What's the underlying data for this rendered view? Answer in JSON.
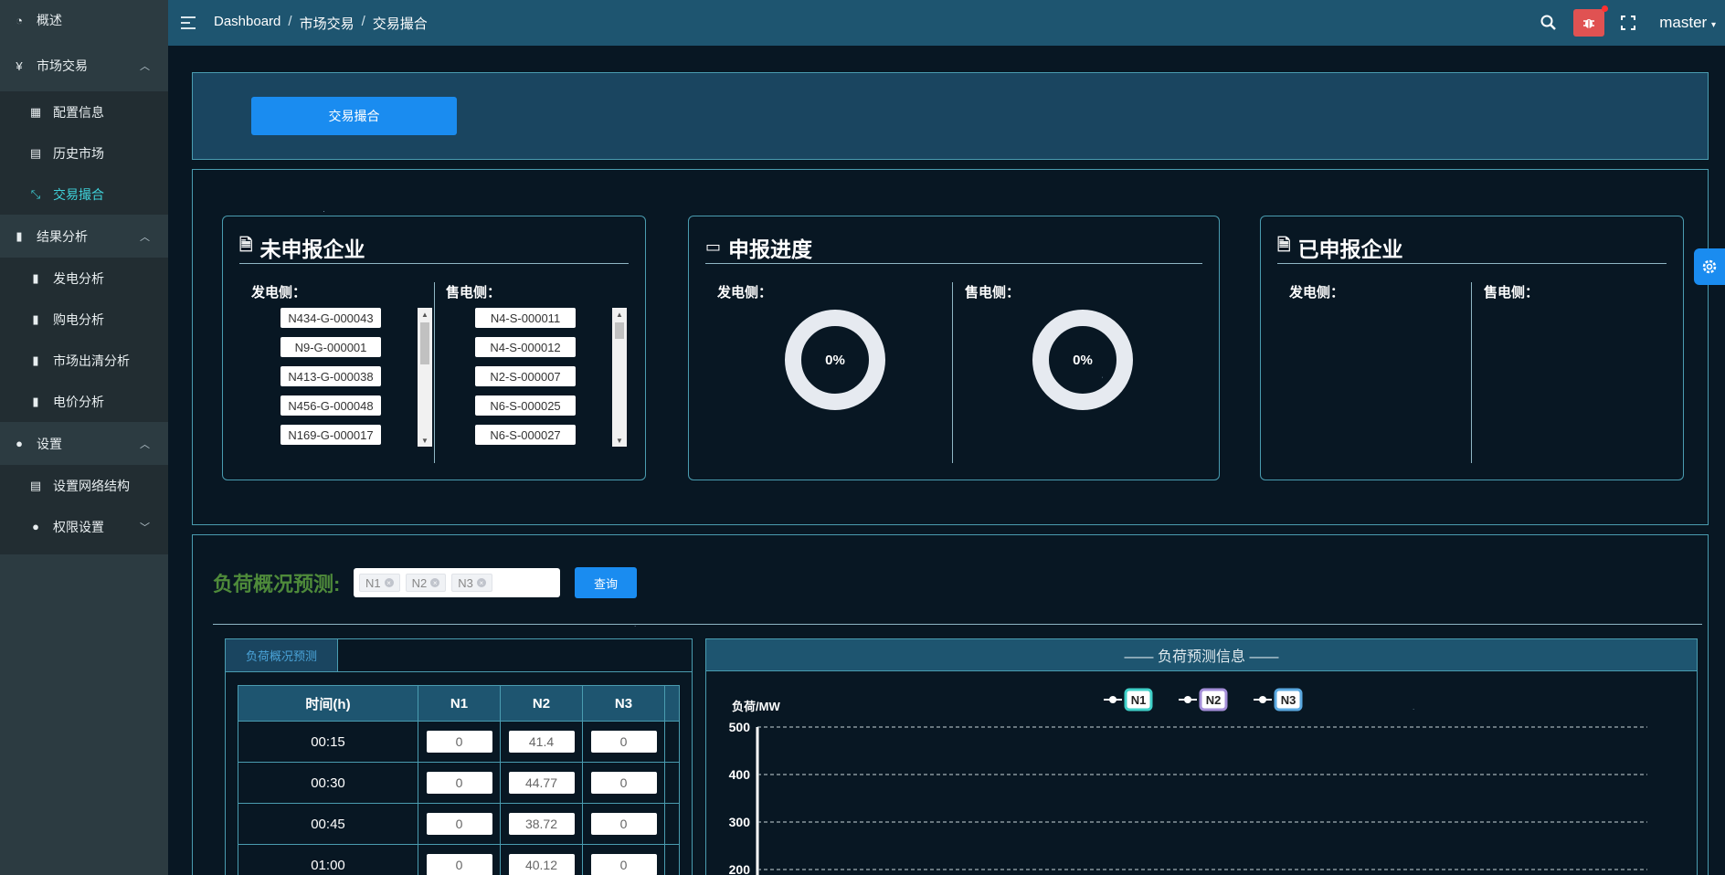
{
  "sidebar": {
    "overview": "概述",
    "market": "市场交易",
    "market_items": [
      "配置信息",
      "历史市场",
      "交易撮合"
    ],
    "analysis": "结果分析",
    "analysis_items": [
      "发电分析",
      "购电分析",
      "市场出清分析",
      "电价分析"
    ],
    "settings": "设置",
    "settings_items": [
      "设置网络结构",
      "权限设置"
    ]
  },
  "header": {
    "breadcrumb": [
      "Dashboard",
      "市场交易",
      "交易撮合"
    ],
    "user": "master"
  },
  "top": {
    "button": "交易撮合"
  },
  "cards": {
    "unreported": {
      "title": "未申报企业",
      "gen_label": "发电侧：",
      "sell_label": "售电侧：",
      "gen_list": [
        "N434-G-000043",
        "N9-G-000001",
        "N413-G-000038",
        "N456-G-000048",
        "N169-G-000017"
      ],
      "sell_list": [
        "N4-S-000011",
        "N4-S-000012",
        "N2-S-000007",
        "N6-S-000025",
        "N6-S-000027"
      ]
    },
    "progress": {
      "title": "申报进度",
      "gen_label": "发电侧：",
      "sell_label": "售电侧：",
      "gen_pct": "0%",
      "sell_pct": "0%"
    },
    "reported": {
      "title": "已申报企业",
      "gen_label": "发电侧：",
      "sell_label": "售电侧："
    }
  },
  "forecast": {
    "title": "负荷概况预测:",
    "nodes": [
      "N1",
      "N2",
      "N3"
    ],
    "query": "查询",
    "tab": "负荷概况预测",
    "columns": [
      "时间(h)",
      "N1",
      "N2",
      "N3"
    ],
    "rows": [
      [
        "00:15",
        "0",
        "41.4",
        "0"
      ],
      [
        "00:30",
        "0",
        "44.77",
        "0"
      ],
      [
        "00:45",
        "0",
        "38.72",
        "0"
      ],
      [
        "01:00",
        "0",
        "40.12",
        "0"
      ]
    ],
    "chart_head": "—— 负荷预测信息 ——"
  },
  "chart_data": {
    "type": "line",
    "ylabel": "负荷/MW",
    "yticks": [
      500,
      400,
      300,
      200
    ],
    "series": [
      {
        "name": "N1",
        "color": "#3fd0c8"
      },
      {
        "name": "N2",
        "color": "#a58fd8"
      },
      {
        "name": "N3",
        "color": "#5aa8e0"
      }
    ]
  }
}
